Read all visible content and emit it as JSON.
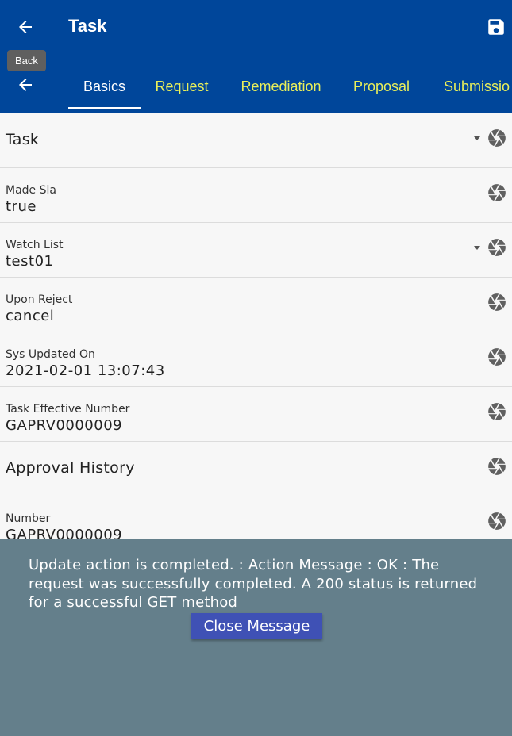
{
  "header": {
    "title": "Task",
    "back_icon": "arrow-left-icon",
    "save_icon": "floppy-disk-icon",
    "tooltip": "Back"
  },
  "tabs": [
    {
      "label": "Basics",
      "active": true
    },
    {
      "label": "Request",
      "active": false
    },
    {
      "label": "Remediation",
      "active": false
    },
    {
      "label": "Proposal",
      "active": false
    },
    {
      "label": "Submissio",
      "active": false
    }
  ],
  "fields": [
    {
      "label": "Task",
      "value": "",
      "dropdown": true
    },
    {
      "label": "Made Sla",
      "value": "true",
      "dropdown": false
    },
    {
      "label": "Watch List",
      "value": "test01",
      "dropdown": true
    },
    {
      "label": "Upon Reject",
      "value": "cancel",
      "dropdown": false
    },
    {
      "label": "Sys Updated On",
      "value": "2021-02-01 13:07:43",
      "dropdown": false
    },
    {
      "label": "Task Effective Number",
      "value": "GAPRV0000009",
      "dropdown": false
    },
    {
      "label": "Approval History",
      "value": "",
      "dropdown": false
    },
    {
      "label": "Number",
      "value": "GAPRV0000009",
      "dropdown": false
    }
  ],
  "message": {
    "text": "Update action is completed.  : Action Message : OK : The request was successfully completed. A 200 status is returned for a successful GET method",
    "close_label": "Close Message"
  },
  "colors": {
    "appbar": "#00469a",
    "tab_inactive": "#e9ef5a",
    "overlay": "#647f8b",
    "button": "#3f51b5"
  }
}
